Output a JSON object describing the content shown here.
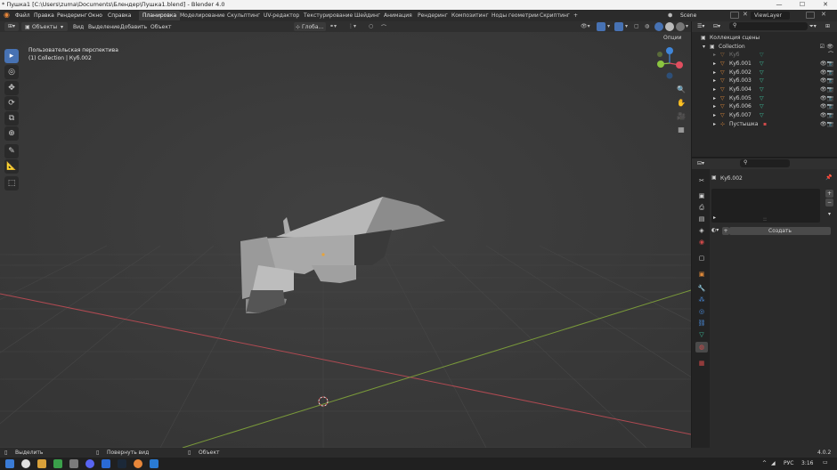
{
  "window": {
    "title": "* Пушка1 [C:\\Users\\zuma\\Documents\\Блендер\\Пушка1.blend] - Blender 4.0",
    "minimize": "—",
    "maximize": "☐",
    "close": "✕"
  },
  "menu": [
    "Файл",
    "Правка",
    "Рендеринг",
    "Окно",
    "Справка"
  ],
  "workspaces": [
    "Планировка",
    "Моделирование",
    "Скульптинг",
    "UV-редактор",
    "Текстурирование",
    "Шейдинг",
    "Анимация",
    "Рендеринг",
    "Композитинг",
    "Ноды геометрии",
    "Скриптинг"
  ],
  "workspace_add": "+",
  "scene": {
    "label": "Scene",
    "viewlayer": "ViewLayer"
  },
  "viewport_header": {
    "mode": "Объекты",
    "menus": [
      "Вид",
      "Выделение",
      "Добавить",
      "Объект"
    ],
    "transform": "Глоба...",
    "options": "Опции"
  },
  "viewport": {
    "info_line1": "Пользовательская перспектива",
    "info_line2": "(1) Collection | Куб.002"
  },
  "gizmo": {
    "x": "X",
    "y": "Y",
    "z": "Z"
  },
  "colors": {
    "accent": "#4772b3",
    "x_axis": "#e04e5f",
    "y_axis": "#8bc540",
    "z_axis": "#3f86d9",
    "mesh_icon": "#e08a3a",
    "data_icon": "#3fc4a0"
  },
  "outliner": {
    "header": "Коллекция сцены",
    "collection": "Collection",
    "items": [
      "Куб",
      "Куб.001",
      "Куб.002",
      "Куб.003",
      "Куб.004",
      "Куб.005",
      "Куб.006",
      "Куб.007",
      "Пустышка"
    ]
  },
  "properties": {
    "object_name": "Куб.002",
    "create_button": "Создать",
    "list_handle": "::"
  },
  "statusbar": {
    "select": "Выделить",
    "rotate": "Повернуть вид",
    "object": "Объект",
    "version": "4.0.2"
  },
  "taskbar": {
    "lang": "РУС",
    "time": "3:16",
    "tray_arrow": "^"
  }
}
